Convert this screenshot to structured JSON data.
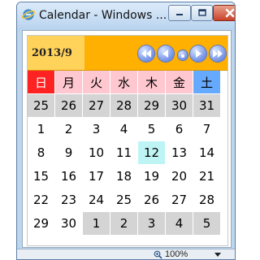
{
  "window": {
    "title": "Calendar - Windows ..."
  },
  "calendar": {
    "month_label": "2013/9",
    "weekdays": [
      "日",
      "月",
      "火",
      "水",
      "木",
      "金",
      "土"
    ],
    "weeks": [
      [
        {
          "d": "25",
          "t": "oth"
        },
        {
          "d": "26",
          "t": "oth"
        },
        {
          "d": "27",
          "t": "oth"
        },
        {
          "d": "28",
          "t": "oth"
        },
        {
          "d": "29",
          "t": "oth"
        },
        {
          "d": "30",
          "t": "oth"
        },
        {
          "d": "31",
          "t": "oth"
        }
      ],
      [
        {
          "d": "1",
          "t": "cur"
        },
        {
          "d": "2",
          "t": "cur"
        },
        {
          "d": "3",
          "t": "cur"
        },
        {
          "d": "4",
          "t": "cur"
        },
        {
          "d": "5",
          "t": "cur"
        },
        {
          "d": "6",
          "t": "cur"
        },
        {
          "d": "7",
          "t": "cur"
        }
      ],
      [
        {
          "d": "8",
          "t": "cur"
        },
        {
          "d": "9",
          "t": "cur"
        },
        {
          "d": "10",
          "t": "cur"
        },
        {
          "d": "11",
          "t": "cur"
        },
        {
          "d": "12",
          "t": "today"
        },
        {
          "d": "13",
          "t": "cur"
        },
        {
          "d": "14",
          "t": "cur"
        }
      ],
      [
        {
          "d": "15",
          "t": "cur"
        },
        {
          "d": "16",
          "t": "cur"
        },
        {
          "d": "17",
          "t": "cur"
        },
        {
          "d": "18",
          "t": "cur"
        },
        {
          "d": "19",
          "t": "cur"
        },
        {
          "d": "20",
          "t": "cur"
        },
        {
          "d": "21",
          "t": "cur"
        }
      ],
      [
        {
          "d": "22",
          "t": "cur"
        },
        {
          "d": "23",
          "t": "cur"
        },
        {
          "d": "24",
          "t": "cur"
        },
        {
          "d": "25",
          "t": "cur"
        },
        {
          "d": "26",
          "t": "cur"
        },
        {
          "d": "27",
          "t": "cur"
        },
        {
          "d": "28",
          "t": "cur"
        }
      ],
      [
        {
          "d": "29",
          "t": "cur"
        },
        {
          "d": "30",
          "t": "cur"
        },
        {
          "d": "1",
          "t": "oth"
        },
        {
          "d": "2",
          "t": "oth"
        },
        {
          "d": "3",
          "t": "oth"
        },
        {
          "d": "4",
          "t": "oth"
        },
        {
          "d": "5",
          "t": "oth"
        }
      ]
    ],
    "nav_buttons": [
      "prev-year",
      "prev-month",
      "today",
      "next-month",
      "next-year"
    ]
  },
  "statusbar": {
    "zoom": "100%"
  },
  "colors": {
    "header": "#ffb000",
    "month_label_bg": "#ffd25a",
    "sunday_header": "#ff2222",
    "weekday_header": "#ffc7cf",
    "saturday_header": "#66aaff",
    "other_month_cell": "#d4d4d4",
    "today_cell": "#bff4f4"
  }
}
